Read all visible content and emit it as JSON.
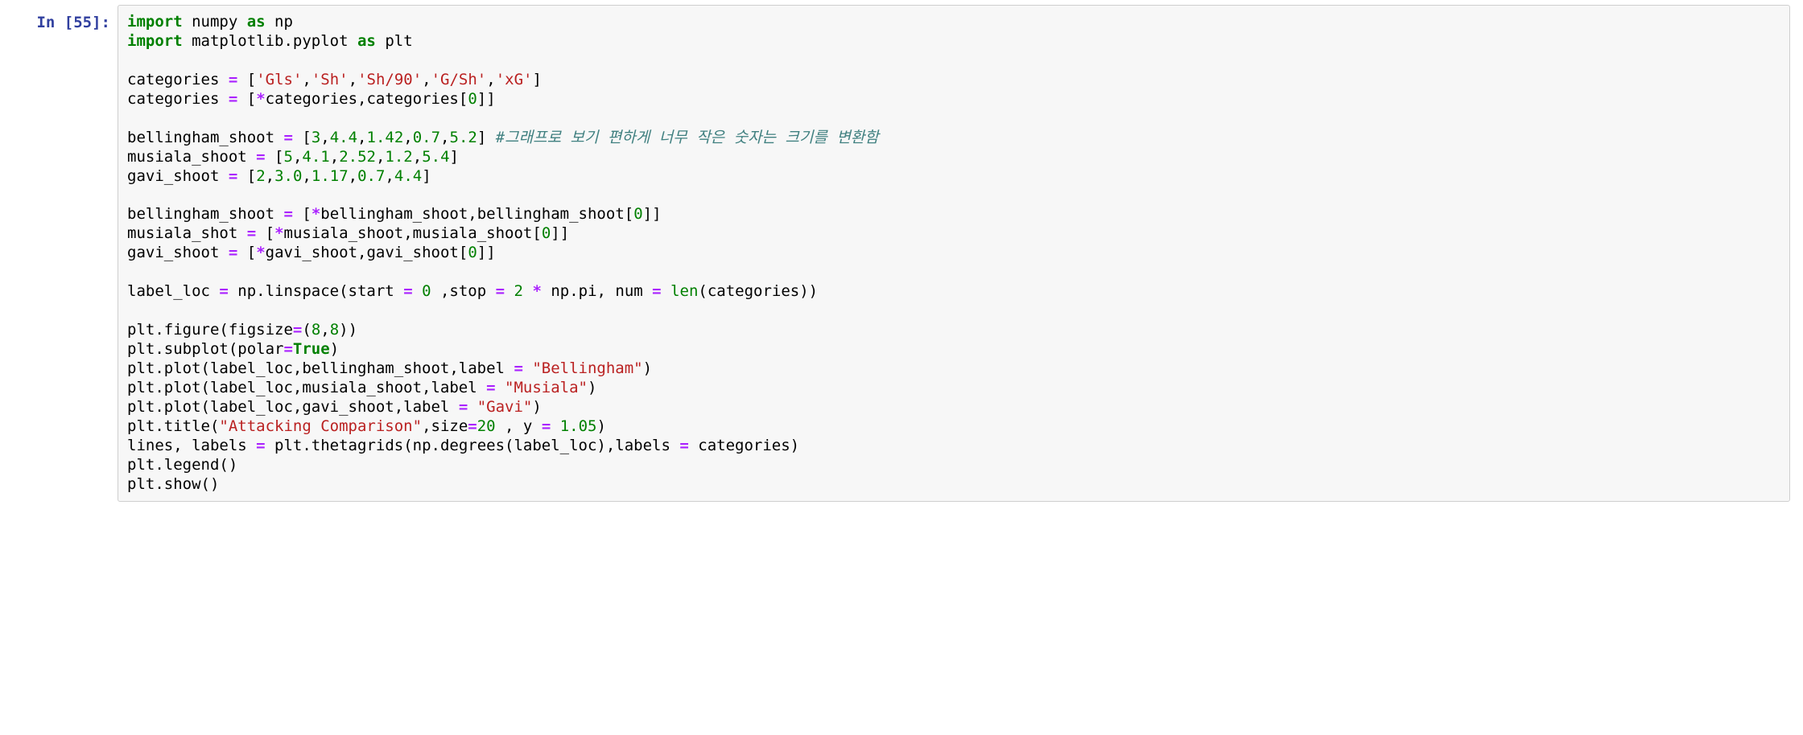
{
  "prompt": "In [55]:",
  "code_lines": [
    [
      {
        "cls": "tok-keyword",
        "text": "import"
      },
      {
        "cls": "tok-name",
        "text": " numpy "
      },
      {
        "cls": "tok-keyword",
        "text": "as"
      },
      {
        "cls": "tok-name",
        "text": " np"
      }
    ],
    [
      {
        "cls": "tok-keyword",
        "text": "import"
      },
      {
        "cls": "tok-name",
        "text": " matplotlib.pyplot "
      },
      {
        "cls": "tok-keyword",
        "text": "as"
      },
      {
        "cls": "tok-name",
        "text": " plt"
      }
    ],
    [],
    [
      {
        "cls": "tok-name",
        "text": "categories "
      },
      {
        "cls": "tok-op",
        "text": "="
      },
      {
        "cls": "tok-name",
        "text": " ["
      },
      {
        "cls": "tok-string",
        "text": "'Gls'"
      },
      {
        "cls": "tok-name",
        "text": ","
      },
      {
        "cls": "tok-string",
        "text": "'Sh'"
      },
      {
        "cls": "tok-name",
        "text": ","
      },
      {
        "cls": "tok-string",
        "text": "'Sh/90'"
      },
      {
        "cls": "tok-name",
        "text": ","
      },
      {
        "cls": "tok-string",
        "text": "'G/Sh'"
      },
      {
        "cls": "tok-name",
        "text": ","
      },
      {
        "cls": "tok-string",
        "text": "'xG'"
      },
      {
        "cls": "tok-name",
        "text": "]"
      }
    ],
    [
      {
        "cls": "tok-name",
        "text": "categories "
      },
      {
        "cls": "tok-op",
        "text": "="
      },
      {
        "cls": "tok-name",
        "text": " ["
      },
      {
        "cls": "tok-op",
        "text": "*"
      },
      {
        "cls": "tok-name",
        "text": "categories,categories["
      },
      {
        "cls": "tok-number",
        "text": "0"
      },
      {
        "cls": "tok-name",
        "text": "]]"
      }
    ],
    [],
    [
      {
        "cls": "tok-name",
        "text": "bellingham_shoot "
      },
      {
        "cls": "tok-op",
        "text": "="
      },
      {
        "cls": "tok-name",
        "text": " ["
      },
      {
        "cls": "tok-number",
        "text": "3"
      },
      {
        "cls": "tok-name",
        "text": ","
      },
      {
        "cls": "tok-number",
        "text": "4.4"
      },
      {
        "cls": "tok-name",
        "text": ","
      },
      {
        "cls": "tok-number",
        "text": "1.42"
      },
      {
        "cls": "tok-name",
        "text": ","
      },
      {
        "cls": "tok-number",
        "text": "0.7"
      },
      {
        "cls": "tok-name",
        "text": ","
      },
      {
        "cls": "tok-number",
        "text": "5.2"
      },
      {
        "cls": "tok-name",
        "text": "] "
      },
      {
        "cls": "tok-comment",
        "text": "#그래프로 보기 편하게 너무 작은 숫자는 크기를 변환함"
      }
    ],
    [
      {
        "cls": "tok-name",
        "text": "musiala_shoot "
      },
      {
        "cls": "tok-op",
        "text": "="
      },
      {
        "cls": "tok-name",
        "text": " ["
      },
      {
        "cls": "tok-number",
        "text": "5"
      },
      {
        "cls": "tok-name",
        "text": ","
      },
      {
        "cls": "tok-number",
        "text": "4.1"
      },
      {
        "cls": "tok-name",
        "text": ","
      },
      {
        "cls": "tok-number",
        "text": "2.52"
      },
      {
        "cls": "tok-name",
        "text": ","
      },
      {
        "cls": "tok-number",
        "text": "1.2"
      },
      {
        "cls": "tok-name",
        "text": ","
      },
      {
        "cls": "tok-number",
        "text": "5.4"
      },
      {
        "cls": "tok-name",
        "text": "]"
      }
    ],
    [
      {
        "cls": "tok-name",
        "text": "gavi_shoot "
      },
      {
        "cls": "tok-op",
        "text": "="
      },
      {
        "cls": "tok-name",
        "text": " ["
      },
      {
        "cls": "tok-number",
        "text": "2"
      },
      {
        "cls": "tok-name",
        "text": ","
      },
      {
        "cls": "tok-number",
        "text": "3.0"
      },
      {
        "cls": "tok-name",
        "text": ","
      },
      {
        "cls": "tok-number",
        "text": "1.17"
      },
      {
        "cls": "tok-name",
        "text": ","
      },
      {
        "cls": "tok-number",
        "text": "0.7"
      },
      {
        "cls": "tok-name",
        "text": ","
      },
      {
        "cls": "tok-number",
        "text": "4.4"
      },
      {
        "cls": "tok-name",
        "text": "]"
      }
    ],
    [],
    [
      {
        "cls": "tok-name",
        "text": "bellingham_shoot "
      },
      {
        "cls": "tok-op",
        "text": "="
      },
      {
        "cls": "tok-name",
        "text": " ["
      },
      {
        "cls": "tok-op",
        "text": "*"
      },
      {
        "cls": "tok-name",
        "text": "bellingham_shoot,bellingham_shoot["
      },
      {
        "cls": "tok-number",
        "text": "0"
      },
      {
        "cls": "tok-name",
        "text": "]]"
      }
    ],
    [
      {
        "cls": "tok-name",
        "text": "musiala_shot "
      },
      {
        "cls": "tok-op",
        "text": "="
      },
      {
        "cls": "tok-name",
        "text": " ["
      },
      {
        "cls": "tok-op",
        "text": "*"
      },
      {
        "cls": "tok-name",
        "text": "musiala_shoot,musiala_shoot["
      },
      {
        "cls": "tok-number",
        "text": "0"
      },
      {
        "cls": "tok-name",
        "text": "]]"
      }
    ],
    [
      {
        "cls": "tok-name",
        "text": "gavi_shoot "
      },
      {
        "cls": "tok-op",
        "text": "="
      },
      {
        "cls": "tok-name",
        "text": " ["
      },
      {
        "cls": "tok-op",
        "text": "*"
      },
      {
        "cls": "tok-name",
        "text": "gavi_shoot,gavi_shoot["
      },
      {
        "cls": "tok-number",
        "text": "0"
      },
      {
        "cls": "tok-name",
        "text": "]]"
      }
    ],
    [],
    [
      {
        "cls": "tok-name",
        "text": "label_loc "
      },
      {
        "cls": "tok-op",
        "text": "="
      },
      {
        "cls": "tok-name",
        "text": " np.linspace(start "
      },
      {
        "cls": "tok-op",
        "text": "="
      },
      {
        "cls": "tok-name",
        "text": " "
      },
      {
        "cls": "tok-number",
        "text": "0"
      },
      {
        "cls": "tok-name",
        "text": " ,stop "
      },
      {
        "cls": "tok-op",
        "text": "="
      },
      {
        "cls": "tok-name",
        "text": " "
      },
      {
        "cls": "tok-number",
        "text": "2"
      },
      {
        "cls": "tok-name",
        "text": " "
      },
      {
        "cls": "tok-op",
        "text": "*"
      },
      {
        "cls": "tok-name",
        "text": " np.pi, num "
      },
      {
        "cls": "tok-op",
        "text": "="
      },
      {
        "cls": "tok-name",
        "text": " "
      },
      {
        "cls": "tok-builtin",
        "text": "len"
      },
      {
        "cls": "tok-name",
        "text": "(categories))"
      }
    ],
    [],
    [
      {
        "cls": "tok-name",
        "text": "plt.figure(figsize"
      },
      {
        "cls": "tok-op",
        "text": "="
      },
      {
        "cls": "tok-name",
        "text": "("
      },
      {
        "cls": "tok-number",
        "text": "8"
      },
      {
        "cls": "tok-name",
        "text": ","
      },
      {
        "cls": "tok-number",
        "text": "8"
      },
      {
        "cls": "tok-name",
        "text": "))"
      }
    ],
    [
      {
        "cls": "tok-name",
        "text": "plt.subplot(polar"
      },
      {
        "cls": "tok-op",
        "text": "="
      },
      {
        "cls": "tok-argTrue",
        "text": "True"
      },
      {
        "cls": "tok-name",
        "text": ")"
      }
    ],
    [
      {
        "cls": "tok-name",
        "text": "plt.plot(label_loc,bellingham_shoot,label "
      },
      {
        "cls": "tok-op",
        "text": "="
      },
      {
        "cls": "tok-name",
        "text": " "
      },
      {
        "cls": "tok-string",
        "text": "\"Bellingham\""
      },
      {
        "cls": "tok-name",
        "text": ")"
      }
    ],
    [
      {
        "cls": "tok-name",
        "text": "plt.plot(label_loc,musiala_shoot,label "
      },
      {
        "cls": "tok-op",
        "text": "="
      },
      {
        "cls": "tok-name",
        "text": " "
      },
      {
        "cls": "tok-string",
        "text": "\"Musiala\""
      },
      {
        "cls": "tok-name",
        "text": ")"
      }
    ],
    [
      {
        "cls": "tok-name",
        "text": "plt.plot(label_loc,gavi_shoot,label "
      },
      {
        "cls": "tok-op",
        "text": "="
      },
      {
        "cls": "tok-name",
        "text": " "
      },
      {
        "cls": "tok-string",
        "text": "\"Gavi\""
      },
      {
        "cls": "tok-name",
        "text": ")"
      }
    ],
    [
      {
        "cls": "tok-name",
        "text": "plt.title("
      },
      {
        "cls": "tok-string",
        "text": "\"Attacking Comparison\""
      },
      {
        "cls": "tok-name",
        "text": ",size"
      },
      {
        "cls": "tok-op",
        "text": "="
      },
      {
        "cls": "tok-number",
        "text": "20"
      },
      {
        "cls": "tok-name",
        "text": " , y "
      },
      {
        "cls": "tok-op",
        "text": "="
      },
      {
        "cls": "tok-name",
        "text": " "
      },
      {
        "cls": "tok-number",
        "text": "1.05"
      },
      {
        "cls": "tok-name",
        "text": ")"
      }
    ],
    [
      {
        "cls": "tok-name",
        "text": "lines, labels "
      },
      {
        "cls": "tok-op",
        "text": "="
      },
      {
        "cls": "tok-name",
        "text": " plt.thetagrids(np.degrees(label_loc),labels "
      },
      {
        "cls": "tok-op",
        "text": "="
      },
      {
        "cls": "tok-name",
        "text": " categories)"
      }
    ],
    [
      {
        "cls": "tok-name",
        "text": "plt.legend()"
      }
    ],
    [
      {
        "cls": "tok-name",
        "text": "plt.show()"
      }
    ]
  ]
}
